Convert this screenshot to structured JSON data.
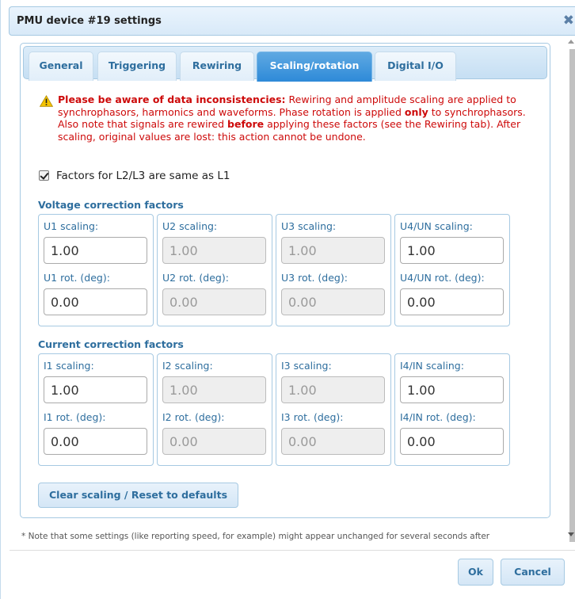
{
  "dialog": {
    "title": "PMU device #19 settings",
    "close_icon": "close-icon"
  },
  "tabs": [
    {
      "label": "General",
      "active": false
    },
    {
      "label": "Triggering",
      "active": false
    },
    {
      "label": "Rewiring",
      "active": false
    },
    {
      "label": "Scaling/rotation",
      "active": true
    },
    {
      "label": "Digital I/O",
      "active": false
    }
  ],
  "warning": {
    "icon": "warning-icon",
    "bold_1": "Please be aware of data inconsistencies:",
    "text_1": " Rewiring and amplitude scaling are applied to synchrophasors, harmonics and waveforms. Phase rotation is applied ",
    "bold_2": "only",
    "text_2": " to synchrophasors. Also note that signals are rewired ",
    "bold_3": "before",
    "text_3": " applying these factors (see the Rewiring tab). After scaling, original values are lost: this action cannot be undone."
  },
  "same_factors": {
    "label": "Factors for L2/L3 are same as L1",
    "checked": true
  },
  "voltage": {
    "title": "Voltage correction factors",
    "groups": [
      {
        "scale_label": "U1 scaling:",
        "scale_value": "1.00",
        "rot_label": "U1 rot. (deg):",
        "rot_value": "0.00",
        "enabled": true
      },
      {
        "scale_label": "U2 scaling:",
        "scale_value": "1.00",
        "rot_label": "U2 rot. (deg):",
        "rot_value": "0.00",
        "enabled": false
      },
      {
        "scale_label": "U3 scaling:",
        "scale_value": "1.00",
        "rot_label": "U3 rot. (deg):",
        "rot_value": "0.00",
        "enabled": false
      },
      {
        "scale_label": "U4/UN scaling:",
        "scale_value": "1.00",
        "rot_label": "U4/UN rot. (deg):",
        "rot_value": "0.00",
        "enabled": true
      }
    ]
  },
  "current": {
    "title": "Current correction factors",
    "groups": [
      {
        "scale_label": "I1 scaling:",
        "scale_value": "1.00",
        "rot_label": "I1 rot. (deg):",
        "rot_value": "0.00",
        "enabled": true
      },
      {
        "scale_label": "I2 scaling:",
        "scale_value": "1.00",
        "rot_label": "I2 rot. (deg):",
        "rot_value": "0.00",
        "enabled": false
      },
      {
        "scale_label": "I3 scaling:",
        "scale_value": "1.00",
        "rot_label": "I3 rot. (deg):",
        "rot_value": "0.00",
        "enabled": false
      },
      {
        "scale_label": "I4/IN scaling:",
        "scale_value": "1.00",
        "rot_label": "I4/IN rot. (deg):",
        "rot_value": "0.00",
        "enabled": true
      }
    ]
  },
  "reset_button": "Clear scaling / Reset to defaults",
  "footnote": "* Note that some settings (like reporting speed, for example) might appear unchanged for several seconds after",
  "buttons": {
    "ok": "Ok",
    "cancel": "Cancel"
  },
  "colors": {
    "accent": "#2e6e9e",
    "active_tab": "#2e8ad8",
    "warning_text": "#cd0a0a",
    "border": "#a6c9e2"
  }
}
